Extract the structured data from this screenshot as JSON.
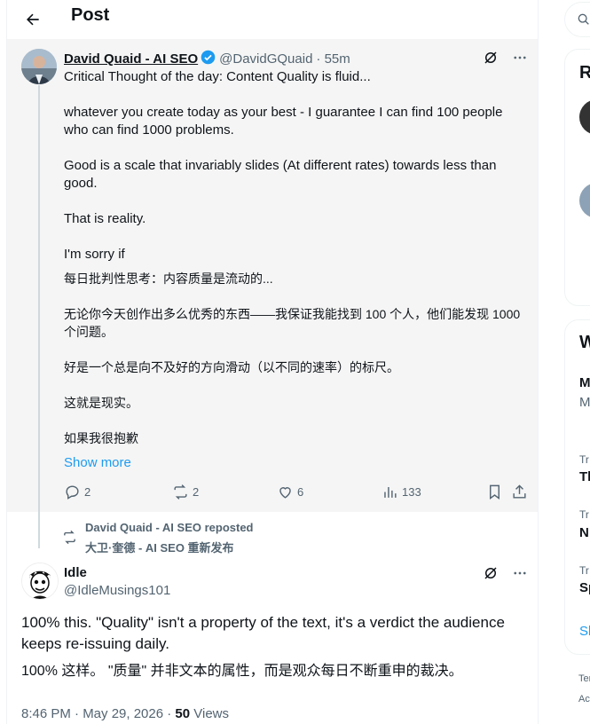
{
  "header": {
    "title": "Post"
  },
  "quoted_post": {
    "author_name": "David Quaid - AI SEO",
    "handle": "@DavidGQuaid",
    "time": "· 55m",
    "lines": [
      "Critical Thought of the day: Content Quality is fluid...",
      "",
      "whatever you create today as your best -  I guarantee I can find 100 people who can find 1000 problems.",
      "",
      "Good is a scale that invariably slides (At different rates) towards less than good.",
      "",
      "That is reality.",
      "",
      "I'm sorry if",
      "每日批判性思考：内容质量是流动的...",
      "",
      "无论你今天创作出多么优秀的东西——我保证我能找到 100 个人，他们能发现 1000 个问题。",
      "",
      "好是一个总是向不及好的方向滑动（以不同的速率）的标尺。",
      "",
      "这就是现实。",
      "",
      "如果我很抱歉"
    ],
    "show_more": "Show more",
    "stats": {
      "replies": "2",
      "reposts": "2",
      "likes": "6",
      "views": "133"
    }
  },
  "repost_note": {
    "line1": "David Quaid - AI SEO reposted",
    "line2": "大卫·奎德 - AI SEO 重新发布"
  },
  "reply": {
    "author_name": "Idle",
    "handle": "@IdleMusings101",
    "text_en": "100% this. \"Quality\" isn't a property of the text, it's a verdict the audience keeps re-issuing daily.",
    "text_zh": "100% 这样。 \"质量\" 并非文本的属性，而是观众每日不断重申的裁决。",
    "timestamp": "8:46 PM · May 29, 2026 · ",
    "views_count": "50",
    "views_label": " Views"
  },
  "sidebar": {
    "card1_title_partial": "R",
    "card2_title_partial": "W",
    "trend_items": [
      {
        "meta": "M",
        "name": "M"
      },
      {
        "meta": "Tr",
        "name": "Th"
      },
      {
        "meta": "Tr",
        "name": "N"
      },
      {
        "meta": "Tr",
        "name": "Sp"
      }
    ],
    "show_partial": "Sh",
    "footer_1": "Ter",
    "footer_2": "Ac"
  },
  "colors": {
    "accent": "#1d9bf0",
    "muted": "#536471",
    "text": "#0f1419"
  }
}
